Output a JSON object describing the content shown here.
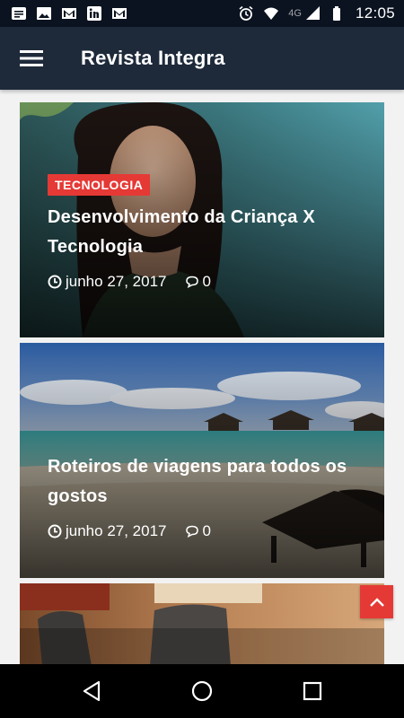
{
  "status_bar": {
    "left_icons": [
      "notes-icon",
      "image-icon",
      "gmail-icon",
      "linkedin-icon",
      "gmail-icon"
    ],
    "right_icons": [
      "alarm-icon",
      "wifi-icon",
      "signal-icon",
      "battery-icon"
    ],
    "network": "4G",
    "time": "12:05"
  },
  "app_bar": {
    "title": "Revista Integra",
    "menu_icon": "hamburger-menu-icon",
    "background": "#1e2a3a"
  },
  "posts": [
    {
      "category": "TECNOLOGIA",
      "title": "Desenvolvimento da Criança X Tecnologia",
      "date": "junho 27, 2017",
      "comments": "0"
    },
    {
      "category": "",
      "title": "Roteiros de viagens para todos os gostos",
      "date": "junho 27, 2017",
      "comments": "0"
    }
  ],
  "colors": {
    "accent": "#e53935",
    "status_bar": "#0b1320"
  },
  "nav_bar": {
    "buttons": [
      "back-icon",
      "home-icon",
      "recents-icon"
    ]
  }
}
